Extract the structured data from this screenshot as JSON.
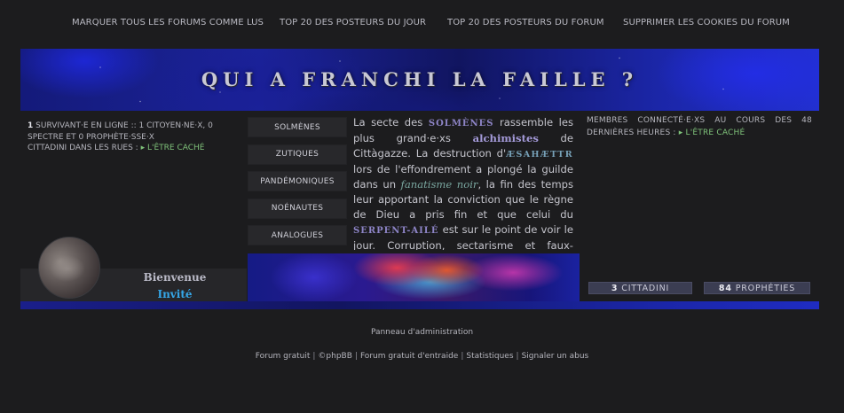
{
  "topnav": {
    "links": [
      "MARQUER TOUS LES FORUMS COMME LUS",
      "TOP 20 DES POSTEURS DU JOUR",
      "TOP 20 DES POSTEURS DU FORUM",
      "SUPPRIMER LES COOKIES DU FORUM"
    ]
  },
  "banner": {
    "title": "QUI A FRANCHI LA FAILLE ?"
  },
  "left_stats": {
    "count": "1",
    "line1_rest": "SURVIVANT·E EN LIGNE :: 1 CITOYEN·NE·X, 0 SPECTRE ET 0 PROPHÈTE·SSE·X",
    "line2_label": "CITTADINI DANS LES RUES :",
    "line2_value": "▸ L'ÊTRE CACHÉ"
  },
  "menu": {
    "items": [
      "SOLMÈNES",
      "ZUTIQUES",
      "PANDÉMONIQUES",
      "NOÉNAUTES",
      "ANALOGUES"
    ]
  },
  "intro": {
    "t1": "La secte des ",
    "solmenes": "SOLMÈNES",
    "t2": " rassemble les plus grand·e·xs ",
    "alchimistes": "alchimistes",
    "t3": " de Cittàgazze. La destruction d'",
    "esahaettr": "ÆSAHÆTTR",
    "t4": " lors de l'effondrement a plongé la guilde dans un ",
    "fanatisme": "fanatisme noir",
    "t5": ", la fin des temps leur apportant la conviction que le règne de Dieu a pris fin et que celui du ",
    "serpent": "SERPENT-AILÉ",
    "t6": " est sur le point de voir le jour. Corruption, sectarisme et faux-semblants"
  },
  "right_stats": {
    "text": "MEMBRES CONNECTÉ·E·XS AU COURS DES 48 DERNIÈRES HEURES :",
    "value": "▸ L'ÊTRE CACHÉ"
  },
  "welcome": {
    "line1": "Bienvenue",
    "line2": "Invité"
  },
  "counters": {
    "cittadini_num": "3",
    "cittadini_label": "CITTADINI",
    "prophecies_num": "84",
    "prophecies_label": "PROPHÉTIES"
  },
  "footer": {
    "admin": "Panneau d'administration",
    "links": [
      "Forum gratuit",
      "©phpBB",
      "Forum gratuit d'entraide",
      "Statistiques",
      "Signaler un abus"
    ]
  },
  "colors": {
    "background": "#1c1c1e",
    "accent_purple": "#8d84c6",
    "accent_green": "#7fc27a",
    "accent_blue": "#35a7e8"
  }
}
